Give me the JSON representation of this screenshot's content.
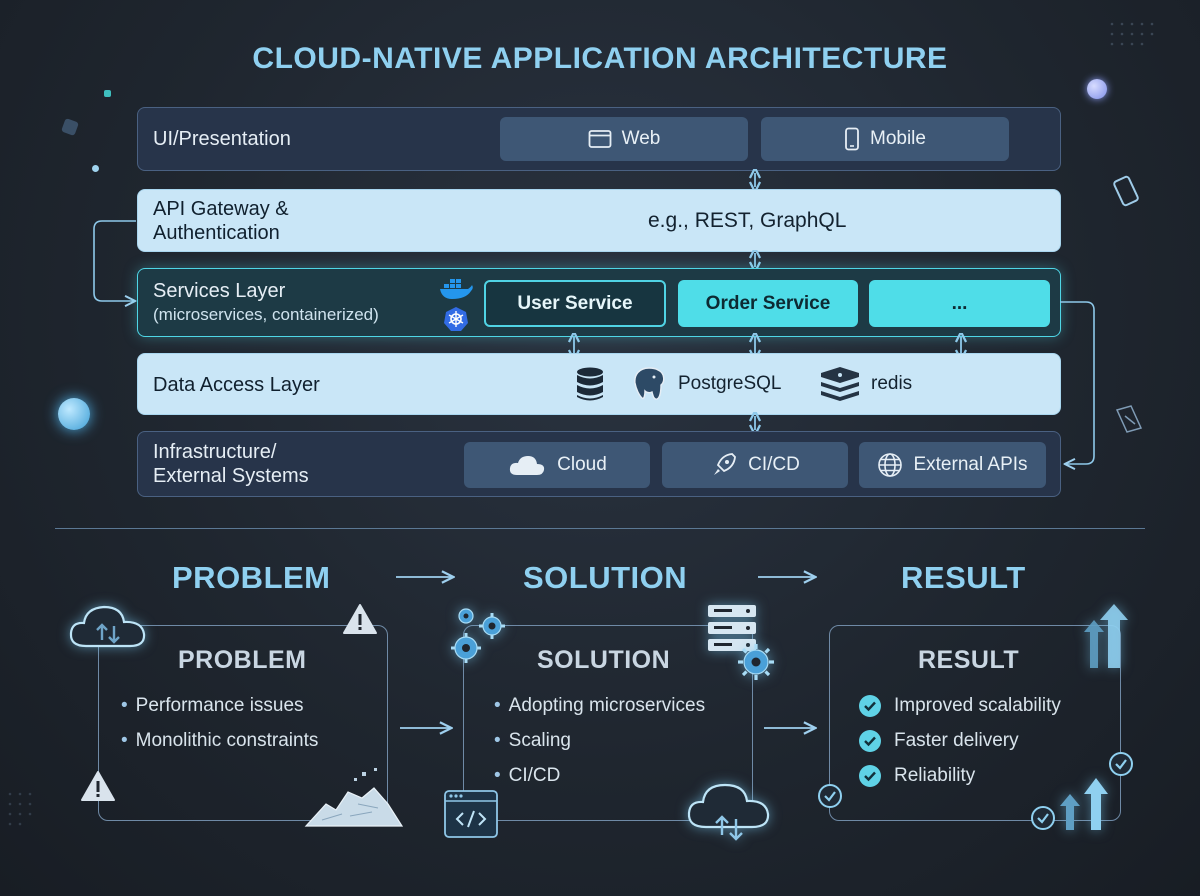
{
  "title": "CLOUD-NATIVE APPLICATION ARCHITECTURE",
  "layers": {
    "ui": {
      "label": "UI/Presentation",
      "chips": [
        "Web",
        "Mobile"
      ]
    },
    "api": {
      "label_line1": "API Gateway &",
      "label_line2": "Authentication",
      "detail": "e.g., REST, GraphQL"
    },
    "services": {
      "label": "Services Layer",
      "sublabel": "(microservices, containerized)",
      "chips": [
        "User Service",
        "Order Service",
        "..."
      ]
    },
    "data": {
      "label": "Data Access Layer",
      "items": [
        "PostgreSQL",
        "redis"
      ]
    },
    "infra": {
      "label_line1": "Infrastructure/",
      "label_line2": "External Systems",
      "chips": [
        "Cloud",
        "CI/CD",
        "External APIs"
      ]
    }
  },
  "flow": {
    "headers": [
      "PROBLEM",
      "SOLUTION",
      "RESULT"
    ],
    "problem": {
      "title": "PROBLEM",
      "items": [
        "Performance issues",
        "Monolithic constraints"
      ]
    },
    "solution": {
      "title": "SOLUTION",
      "items": [
        "Adopting microservices",
        "Scaling",
        "CI/CD"
      ]
    },
    "result": {
      "title": "RESULT",
      "items": [
        "Improved scalability",
        "Faster delivery",
        "Reliability"
      ]
    }
  },
  "icons": [
    "browser-window-icon",
    "mobile-phone-icon",
    "docker-icon",
    "kubernetes-icon",
    "database-icon",
    "postgresql-icon",
    "redis-icon",
    "cloud-icon",
    "rocket-icon",
    "globe-icon",
    "gear-icon",
    "server-stack-icon",
    "code-window-icon",
    "cloud-sync-icon",
    "warning-icon",
    "rubble-icon",
    "up-arrows-icon",
    "check-icon"
  ],
  "colors": {
    "accent": "#8fd0f0",
    "cyan": "#4fdde8",
    "background": "#1f262f"
  }
}
